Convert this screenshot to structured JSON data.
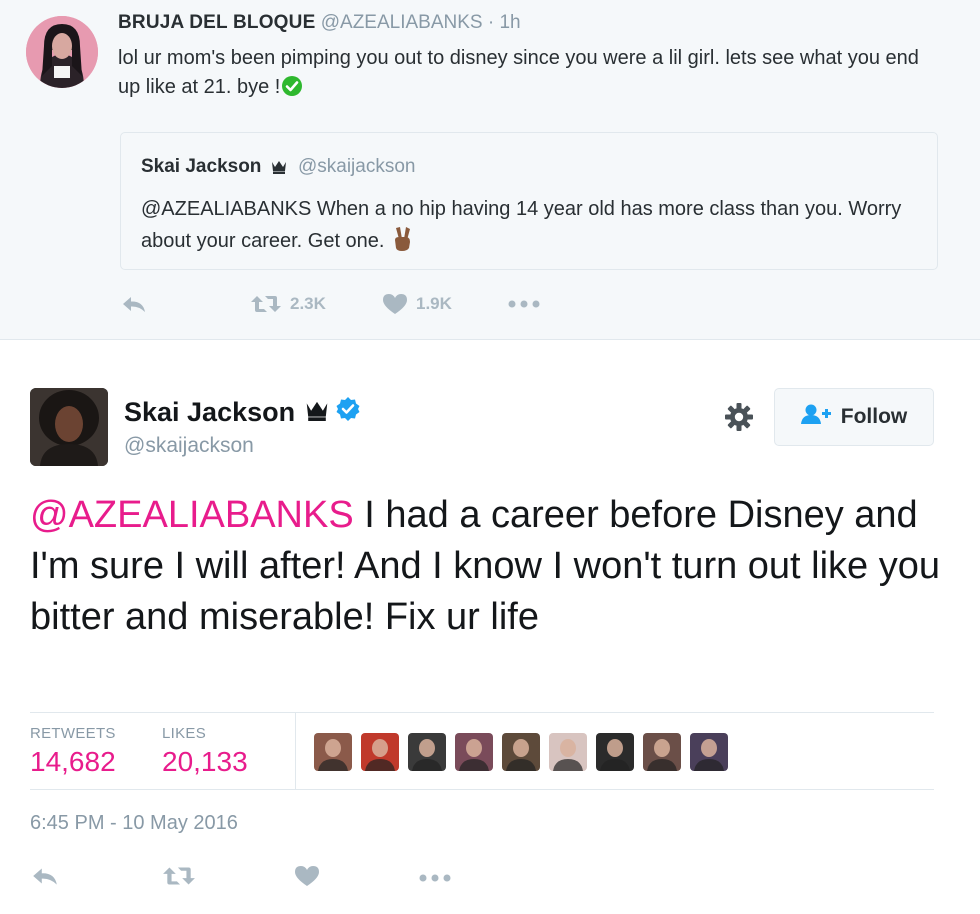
{
  "parent_tweet": {
    "display_name": "BRUJA DEL BLOQUE",
    "handle": "@AZEALIABANKS",
    "separator": "·",
    "time": "1h",
    "text": "lol ur mom's been pimping you out to disney since you were a lil girl. lets see what you end up like at 21.  bye !",
    "quoted": {
      "display_name": "Skai Jackson",
      "handle": "@skaijackson",
      "text": "@AZEALIABANKS When a no hip having 14 year old has more class than you. Worry about your career. Get one."
    },
    "actions": {
      "retweet_count": "2.3K",
      "like_count": "1.9K"
    }
  },
  "main_tweet": {
    "display_name": "Skai Jackson",
    "handle": "@skaijackson",
    "follow_label": "Follow",
    "mention": "@AZEALIABANKS",
    "text": " I had a career before Disney and I'm sure I will after! And I know I won't turn out like you bitter and miserable! Fix ur life",
    "stats": {
      "retweets_label": "RETWEETS",
      "retweets_value": "14,682",
      "likes_label": "LIKES",
      "likes_value": "20,133"
    },
    "liker_avatar_colors": [
      "#8b5a4a",
      "#c0392b",
      "#3a3a3a",
      "#7a4b5a",
      "#5d4a3a",
      "#d8c4c0",
      "#2b2b2b",
      "#6b4f48",
      "#4a3f5a"
    ],
    "timestamp": "6:45 PM - 10 May 2016"
  },
  "colors": {
    "mention": "#e81c8c",
    "muted": "#8899a6",
    "icon_muted": "#aab8c2",
    "verified": "#1da1f2",
    "follow_icon": "#1da1f2"
  },
  "icons": [
    "reply-icon",
    "retweet-icon",
    "heart-icon",
    "more-icon",
    "gear-icon",
    "follow-user-icon",
    "verified-icon",
    "crown-icon",
    "checkmark-icon",
    "peace-sign-icon"
  ]
}
